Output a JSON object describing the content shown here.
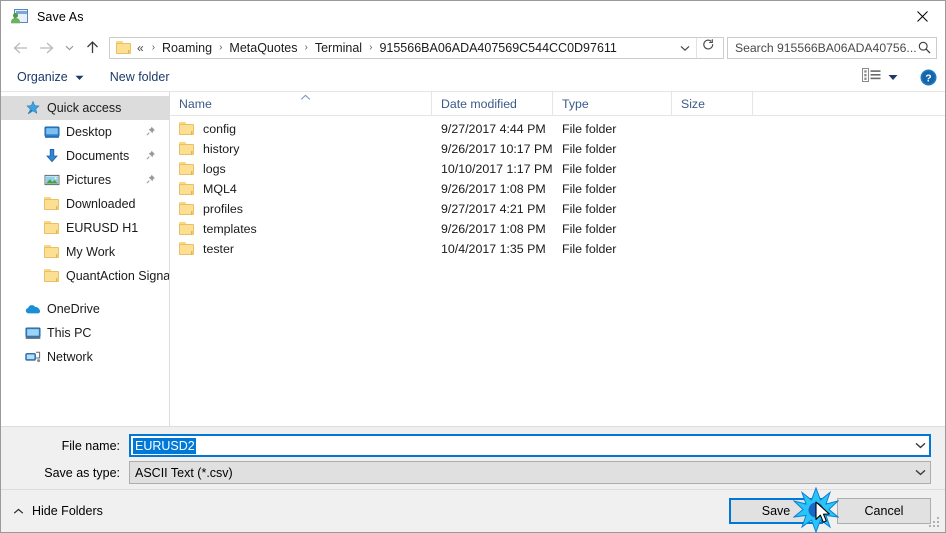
{
  "window": {
    "title": "Save As",
    "icon": "save-as-icon",
    "close_label": "Close"
  },
  "nav": {
    "back": "Back",
    "forward": "Forward",
    "recent": "Recent locations",
    "up": "Up one level",
    "breadcrumb_prefix": "«",
    "crumbs": [
      "Roaming",
      "MetaQuotes",
      "Terminal",
      "915566BA06ADA407569C544CC0D97611"
    ],
    "separator": "›",
    "dropdown": "chevron-down-icon",
    "refresh": "refresh-icon"
  },
  "search": {
    "placeholder": "Search 915566BA06ADA40756...",
    "icon": "search-icon"
  },
  "toolbar": {
    "organize": "Organize",
    "new_folder": "New folder",
    "view_icon": "view-layout-icon",
    "help_icon": "help-icon"
  },
  "sidebar": {
    "items": [
      {
        "label": "Quick access",
        "icon": "quick-access-star-icon",
        "level": 0,
        "selected": true,
        "pinned": false
      },
      {
        "label": "Desktop",
        "icon": "desktop-icon",
        "level": 1,
        "selected": false,
        "pinned": true
      },
      {
        "label": "Documents",
        "icon": "documents-download-icon",
        "level": 1,
        "selected": false,
        "pinned": true
      },
      {
        "label": "Pictures",
        "icon": "pictures-icon",
        "level": 1,
        "selected": false,
        "pinned": true
      },
      {
        "label": "Downloaded",
        "icon": "folder-icon",
        "level": 1,
        "selected": false,
        "pinned": false
      },
      {
        "label": "EURUSD H1",
        "icon": "folder-icon",
        "level": 1,
        "selected": false,
        "pinned": false
      },
      {
        "label": "My Work",
        "icon": "folder-icon",
        "level": 1,
        "selected": false,
        "pinned": false
      },
      {
        "label": "QuantAction Signal",
        "icon": "folder-icon",
        "level": 1,
        "selected": false,
        "pinned": false
      },
      {
        "label": "OneDrive",
        "icon": "onedrive-cloud-icon",
        "level": 0,
        "selected": false,
        "pinned": false
      },
      {
        "label": "This PC",
        "icon": "this-pc-icon",
        "level": 0,
        "selected": false,
        "pinned": false
      },
      {
        "label": "Network",
        "icon": "network-icon",
        "level": 0,
        "selected": false,
        "pinned": false
      }
    ]
  },
  "filelist": {
    "columns": [
      "Name",
      "Date modified",
      "Type",
      "Size"
    ],
    "sort": {
      "column": "Name",
      "direction": "ascending"
    },
    "rows": [
      {
        "name": "config",
        "date": "9/27/2017 4:44 PM",
        "type": "File folder",
        "size": ""
      },
      {
        "name": "history",
        "date": "9/26/2017 10:17 PM",
        "type": "File folder",
        "size": ""
      },
      {
        "name": "logs",
        "date": "10/10/2017 1:17 PM",
        "type": "File folder",
        "size": ""
      },
      {
        "name": "MQL4",
        "date": "9/26/2017 1:08 PM",
        "type": "File folder",
        "size": ""
      },
      {
        "name": "profiles",
        "date": "9/27/2017 4:21 PM",
        "type": "File folder",
        "size": ""
      },
      {
        "name": "templates",
        "date": "9/26/2017 1:08 PM",
        "type": "File folder",
        "size": ""
      },
      {
        "name": "tester",
        "date": "10/4/2017 1:35 PM",
        "type": "File folder",
        "size": ""
      }
    ]
  },
  "form": {
    "file_name_label": "File name:",
    "file_name_value": "EURUSD2",
    "save_as_type_label": "Save as type:",
    "save_as_type_value": "ASCII Text (*.csv)"
  },
  "footer": {
    "hide_folders": "Hide Folders",
    "save": "Save",
    "cancel": "Cancel"
  },
  "colors": {
    "accent": "#0078d7",
    "selection": "#0078d7",
    "folder": "#fcdf92",
    "header_text": "#3a5a87",
    "dialog_bg": "#f0f0f0"
  }
}
